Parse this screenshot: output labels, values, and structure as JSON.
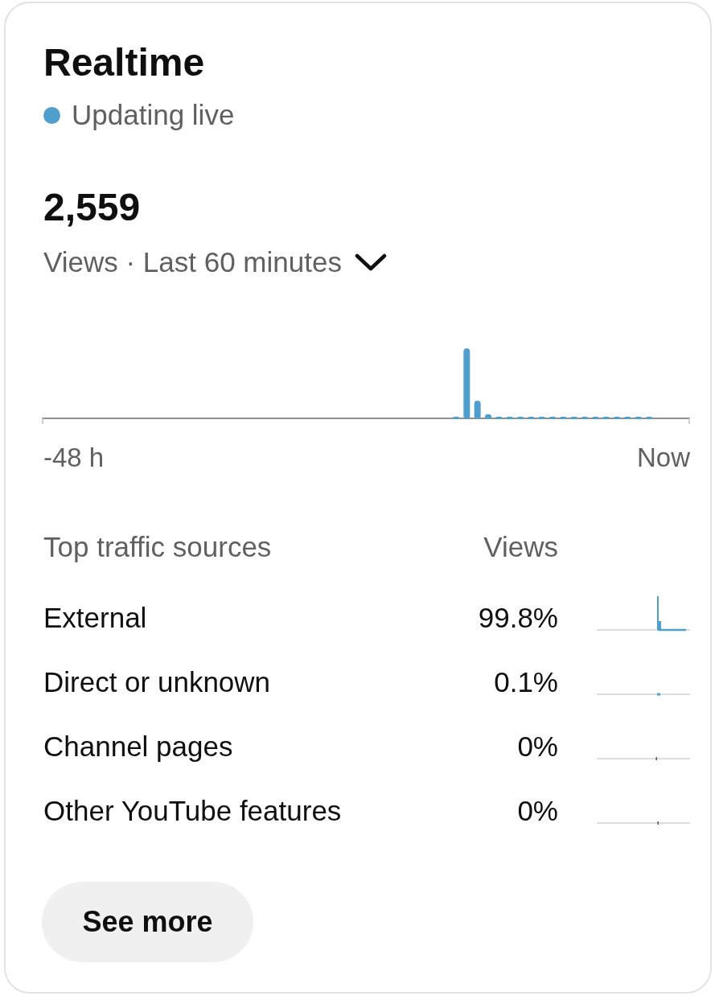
{
  "card": {
    "title": "Realtime",
    "status": "Updating live",
    "total": "2,559",
    "metric_selector": "Views · Last 60 minutes"
  },
  "chart": {
    "start_label": "-48 h",
    "end_label": "Now"
  },
  "traffic": {
    "columns": [
      "Top traffic sources",
      "Views"
    ],
    "rows": [
      {
        "source": "External",
        "views": "99.8%"
      },
      {
        "source": "Direct or unknown",
        "views": "0.1%"
      },
      {
        "source": "Channel pages",
        "views": "0%"
      },
      {
        "source": "Other YouTube features",
        "views": "0%"
      }
    ]
  },
  "button": {
    "label": "See more"
  }
}
